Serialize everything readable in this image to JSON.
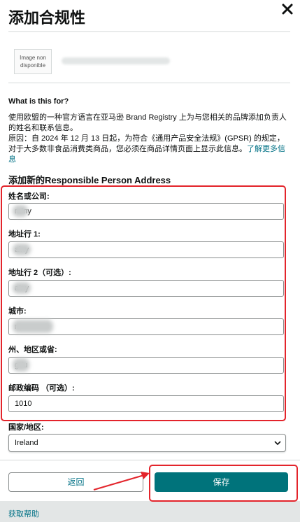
{
  "dialog": {
    "title": "添加合规性",
    "close_icon": "close-icon"
  },
  "product": {
    "image_placeholder": "Image non disponible"
  },
  "info": {
    "heading": "What is this for?",
    "paragraph1": "使用欧盟的一种官方语言在亚马逊 Brand Registry 上为与您相关的品牌添加负责人的姓名和联系信息。",
    "paragraph2": "原因：自 2024 年 12 月 13 日起，为符合《通用产品安全法规》(GPSR) 的规定，对于大多数非食品消费类商品，您必须在商品详情页面上显示此信息。",
    "learn_more": "了解更多信息"
  },
  "form": {
    "section_title": "添加新的Responsible Person Address",
    "name_label": "姓名或公司:",
    "name_value": "rainy",
    "address1_label": "地址行 1:",
    "address1_value": "ainy",
    "address2_label": "地址行 2（可选）:",
    "address2_value": "ainy",
    "city_label": "城市:",
    "city_value": "n",
    "state_label": "州、地区或省:",
    "state_value": "gdu",
    "postal_label": "邮政编码 （可选）:",
    "postal_value": "1010",
    "country_label": "国家/地区:",
    "country_value": "Ireland"
  },
  "footer": {
    "back_label": "返回",
    "save_label": "保存",
    "help_label": "获取帮助"
  },
  "colors": {
    "accent": "#00737b",
    "link": "#007185",
    "annotation": "#e3242b"
  }
}
